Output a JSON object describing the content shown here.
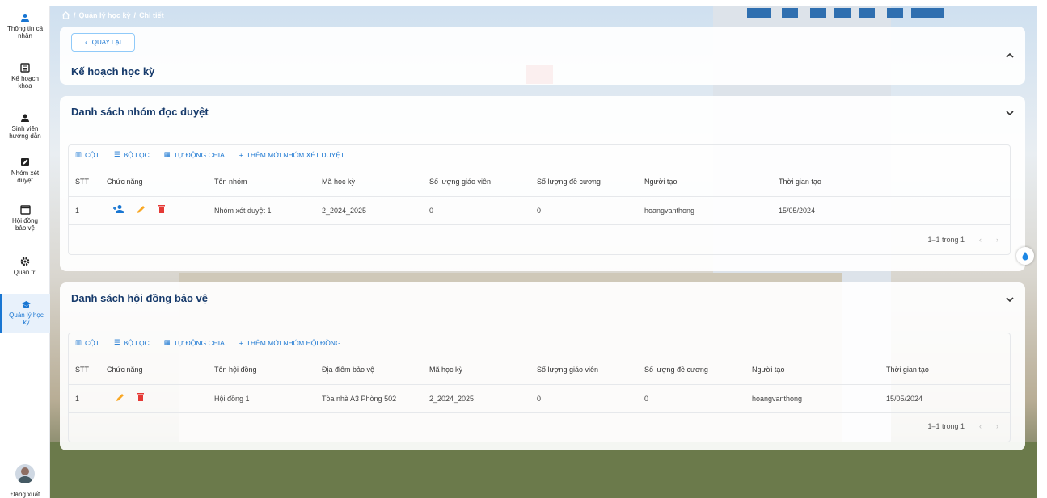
{
  "sidebar": {
    "items": [
      {
        "label1": "Thông tin cá",
        "label2": "nhân"
      },
      {
        "label1": "Kế hoạch",
        "label2": "khoa"
      },
      {
        "label1": "Sinh viên",
        "label2": "hướng dẫn"
      },
      {
        "label1": "Nhóm xét",
        "label2": "duyệt"
      },
      {
        "label1": "Hội đồng",
        "label2": "bảo vệ"
      },
      {
        "label1": "Quản trị",
        "label2": ""
      },
      {
        "label1": "Quản lý học",
        "label2": "kỳ"
      }
    ],
    "logout": "Đăng xuất",
    "accent": "#1976d2"
  },
  "breadcrumb": {
    "part1": "Quản lý học kỳ",
    "sep": "/",
    "part2": "Chi tiết"
  },
  "plan": {
    "back_label": "QUAY LẠI",
    "title": "Kế hoạch học kỳ"
  },
  "review": {
    "title": "Danh sách nhóm đọc duyệt",
    "toolbar": {
      "columns": "CỘT",
      "filter": "BỘ LỌC",
      "auto": "TỰ ĐỘNG CHIA",
      "add": "THÊM MỚI NHÓM XÉT DUYỆT"
    },
    "headers": [
      "STT",
      "Chức năng",
      "Tên nhóm",
      "Mã học kỳ",
      "Số lượng giáo viên",
      "Số lượng đề cương",
      "Người tạo",
      "Thời gian tạo"
    ],
    "row": {
      "stt": "1",
      "name": "Nhóm xét duyệt 1",
      "semester": "2_2024_2025",
      "teachers": "0",
      "outlines": "0",
      "creator": "hoangvanthong",
      "created": "15/05/2024"
    },
    "pagination": "1–1 trong 1"
  },
  "council": {
    "title": "Danh sách hội đồng bảo vệ",
    "toolbar": {
      "columns": "CỘT",
      "filter": "BỘ LỌC",
      "auto": "TỰ ĐỘNG CHIA",
      "add": "THÊM MỚI NHÓM HỘI ĐỒNG"
    },
    "headers": [
      "STT",
      "Chức năng",
      "Tên hội đồng",
      "Địa điểm bảo vệ",
      "Mã học kỳ",
      "Số lượng giáo viên",
      "Số lượng đề cương",
      "Người tạo",
      "Thời gian tạo"
    ],
    "row": {
      "stt": "1",
      "name": "Hội đồng 1",
      "location": "Tòa nhà A3 Phòng 502",
      "semester": "2_2024_2025",
      "teachers": "0",
      "outlines": "0",
      "creator": "hoangvanthong",
      "created": "15/05/2024"
    },
    "pagination": "1–1 trong 1"
  }
}
